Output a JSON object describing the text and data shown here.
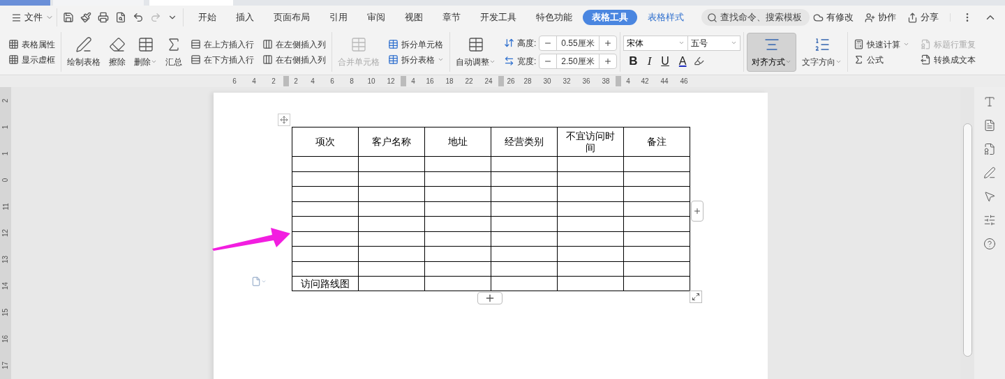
{
  "menu_bar": {
    "file_menu": "文件",
    "tabs": [
      {
        "label": "开始",
        "selected": false,
        "contextual": false
      },
      {
        "label": "插入",
        "selected": false,
        "contextual": false
      },
      {
        "label": "页面布局",
        "selected": false,
        "contextual": false
      },
      {
        "label": "引用",
        "selected": false,
        "contextual": false
      },
      {
        "label": "审阅",
        "selected": false,
        "contextual": false
      },
      {
        "label": "视图",
        "selected": false,
        "contextual": false
      },
      {
        "label": "章节",
        "selected": false,
        "contextual": false
      },
      {
        "label": "开发工具",
        "selected": false,
        "contextual": false
      },
      {
        "label": "特色功能",
        "selected": false,
        "contextual": false
      },
      {
        "label": "表格工具",
        "selected": true,
        "contextual": true
      },
      {
        "label": "表格样式",
        "selected": false,
        "contextual": true
      }
    ],
    "search": {
      "placeholder": "查找命令、搜索模板"
    },
    "actions": [
      "有修改",
      "协作",
      "分享"
    ]
  },
  "ribbon": {
    "table_options": [
      {
        "label": "表格属性"
      },
      {
        "label": "显示虚框"
      }
    ],
    "draw_tools": [
      {
        "label": "绘制表格",
        "dropdown": false
      },
      {
        "label": "擦除",
        "dropdown": false
      },
      {
        "label": "删除",
        "dropdown": true
      },
      {
        "label": "汇总",
        "dropdown": false
      }
    ],
    "insert_rows": [
      "在上方插入行",
      "在下方插入行"
    ],
    "insert_columns": [
      "在左侧插入列",
      "在右侧插入列"
    ],
    "merge": {
      "label": "合并单元格",
      "disabled": true
    },
    "split": [
      {
        "label": "拆分单元格",
        "dropdown": false
      },
      {
        "label": "拆分表格",
        "dropdown": true
      }
    ],
    "auto_fit": {
      "label": "自动调整",
      "dropdown": true
    },
    "size_fields": [
      {
        "label": "高度:",
        "value": "0.55厘米"
      },
      {
        "label": "宽度:",
        "value": "2.50厘米"
      }
    ],
    "font": {
      "family": "宋体",
      "size": "五号"
    },
    "format_buttons": [
      {
        "kind": "bold",
        "label": "B"
      },
      {
        "kind": "italic",
        "label": "I"
      },
      {
        "kind": "underline",
        "label": "U"
      },
      {
        "kind": "color",
        "label": "A"
      }
    ],
    "alignment": {
      "label": "对齐方式",
      "selected": true
    },
    "text_direction": {
      "label": "文字方向"
    },
    "calc": [
      {
        "label": "快速计算",
        "dropdown": true,
        "disabled": false
      },
      {
        "label": "标题行重复",
        "dropdown": false,
        "disabled": true
      },
      {
        "label": "公式",
        "dropdown": false,
        "disabled": false
      },
      {
        "label": "转换成文本",
        "dropdown": false,
        "disabled": false
      }
    ]
  },
  "ruler": {
    "ticks": [
      "6",
      "4",
      "2",
      "2",
      "4",
      "6",
      "8",
      "10",
      "12",
      "4",
      "16",
      "18",
      "22",
      "24",
      "26",
      "28",
      "30",
      "32",
      "36",
      "38",
      "4",
      "42",
      "44",
      "46"
    ],
    "vertical_ticks": [
      "2",
      "1",
      "1",
      "0",
      "11",
      "12",
      "13",
      "14",
      "15",
      "16",
      "17"
    ]
  },
  "document": {
    "table": {
      "header": [
        "项次",
        "客户名称",
        "地址",
        "经营类别",
        "不宜访问时间",
        "备注"
      ],
      "last_row": [
        "访问路线图"
      ]
    }
  }
}
